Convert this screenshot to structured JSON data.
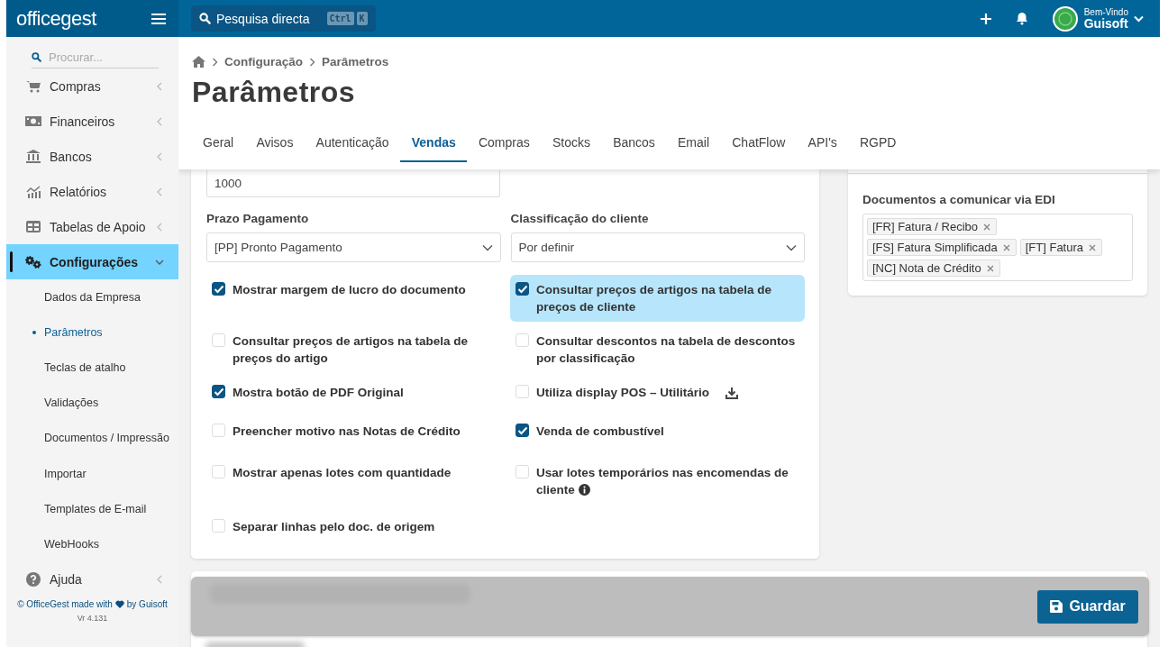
{
  "header": {
    "logo": "officegest",
    "search": {
      "label": "Pesquisa directa",
      "keys": [
        "Ctrl",
        "K"
      ]
    },
    "user": {
      "greeting": "Bem-Vindo",
      "name": "Guisoft"
    }
  },
  "sidebar": {
    "search": {
      "placeholder": "Procurar..."
    },
    "items": [
      {
        "label": "Compras",
        "selected": false,
        "expanded": false
      },
      {
        "label": "Financeiros",
        "selected": false,
        "expanded": false
      },
      {
        "label": "Bancos",
        "selected": false,
        "expanded": false
      },
      {
        "label": "Relatórios",
        "selected": false,
        "expanded": false
      },
      {
        "label": "Tabelas de Apoio",
        "selected": false,
        "expanded": false
      },
      {
        "label": "Configurações",
        "selected": true,
        "expanded": true,
        "children": [
          {
            "label": "Dados da Empresa",
            "selected": false
          },
          {
            "label": "Parâmetros",
            "selected": true
          },
          {
            "label": "Teclas de atalho",
            "selected": false
          },
          {
            "label": "Validações",
            "selected": false
          },
          {
            "label": "Documentos / Impressão",
            "selected": false
          },
          {
            "label": "Importar",
            "selected": false
          },
          {
            "label": "Templates de E-mail",
            "selected": false
          },
          {
            "label": "WebHooks",
            "selected": false
          }
        ]
      },
      {
        "label": "Ajuda",
        "selected": false,
        "expanded": false
      }
    ],
    "footer": {
      "credit_start": "© OfficeGest made with",
      "credit_end": "by Guisoft",
      "version": "Vr 4.131"
    }
  },
  "breadcrumb": [
    "Configuração",
    "Parâmetros"
  ],
  "page_title": "Parâmetros",
  "tabs": [
    {
      "label": "Geral",
      "selected": false
    },
    {
      "label": "Avisos",
      "selected": false
    },
    {
      "label": "Autenticação",
      "selected": false
    },
    {
      "label": "Vendas",
      "selected": true
    },
    {
      "label": "Compras",
      "selected": false
    },
    {
      "label": "Stocks",
      "selected": false
    },
    {
      "label": "Bancos",
      "selected": false
    },
    {
      "label": "Email",
      "selected": false
    },
    {
      "label": "ChatFlow",
      "selected": false
    },
    {
      "label": "API's",
      "selected": false
    },
    {
      "label": "RGPD",
      "selected": false
    }
  ],
  "form": {
    "top_input": {
      "value": "1000"
    },
    "selects": [
      {
        "label": "Prazo Pagamento",
        "value": "[PP] Pronto Pagamento"
      },
      {
        "label": "Classificação do cliente",
        "value": "Por definir"
      }
    ],
    "options": [
      {
        "kind": "plain",
        "label": "Mostrar margem de lucro do documento",
        "checked": true,
        "highlighted": false
      },
      {
        "kind": "plain",
        "label": "Consultar preços de artigos na tabela de preços de cliente",
        "checked": true,
        "highlighted": true
      },
      {
        "kind": "plain",
        "label": "Consultar preços de artigos na tabela de preços do artigo",
        "checked": false,
        "highlighted": false
      },
      {
        "kind": "plain",
        "label": "Consultar descontos na tabela de descontos por classificação",
        "checked": false,
        "highlighted": false
      },
      {
        "kind": "plain",
        "label": "Mostra botão de PDF Original",
        "checked": true,
        "highlighted": false
      },
      {
        "kind": "download",
        "label": "Utiliza display POS – Utilitário",
        "checked": false,
        "highlighted": false
      },
      {
        "kind": "plain",
        "label": "Preencher motivo nas Notas de Crédito",
        "checked": false,
        "highlighted": false
      },
      {
        "kind": "plain",
        "label": "Venda de combustível",
        "checked": true,
        "highlighted": false
      },
      {
        "kind": "plain",
        "label": "Mostrar apenas lotes com quantidade",
        "checked": false,
        "highlighted": false
      },
      {
        "kind": "info",
        "label": "Usar lotes temporários nas encomendas de cliente",
        "checked": false,
        "highlighted": false
      },
      {
        "kind": "plain",
        "label": "Separar linhas pelo doc. de origem",
        "checked": false,
        "highlighted": false
      }
    ]
  },
  "edi": {
    "label": "Documentos a comunicar via EDI",
    "tags": [
      "[FR] Fatura / Recibo",
      "[FS] Fatura Simplificada",
      "[FT] Fatura",
      "[NC] Nota de Crédito"
    ]
  },
  "save_button": "Guardar"
}
